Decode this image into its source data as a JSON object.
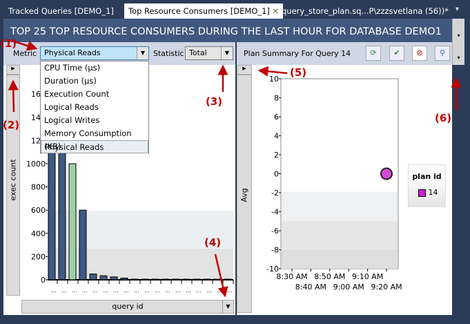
{
  "tabs": [
    {
      "label": "Tracked Queries [DEMO_1]"
    },
    {
      "label": "Top Resource Consumers [DEMO_1]",
      "active": true,
      "close": "✕"
    },
    {
      "label": "query_store_plan.sq...P\\zzzsvetlana (56))*"
    }
  ],
  "header": {
    "title": "TOP 25 TOP RESOURCE CONSUMERS DURING THE LAST HOUR FOR DATABASE DEMO1"
  },
  "toolbar": {
    "metric_label": "Metric",
    "metric_value": "Physical Reads",
    "statistic_label": "Statistic",
    "statistic_value": "Total"
  },
  "metric_options": [
    "CPU Time (µs)",
    "Duration (µs)",
    "Execution Count",
    "Logical Reads",
    "Logical Writes",
    "Memory Consumption (KB)",
    "Physical Reads"
  ],
  "right_toolbar": {
    "title": "Plan Summary For Query 14",
    "icons": [
      "refresh-icon",
      "force-plan-icon",
      "unforce-plan-icon",
      "compare-plans-icon"
    ]
  },
  "annotations": [
    "(1)",
    "(2)",
    "(3)",
    "(4)",
    "(5)",
    "(6)"
  ],
  "colors": {
    "accent": "#41587e",
    "annotation": "#c00000",
    "bar": "#3d5a85",
    "bar_selected": "#9fcfa6",
    "point": "#d84ad8"
  },
  "chart_data": [
    {
      "type": "bar",
      "ylabel": "exec count",
      "xlabel": "query id",
      "ylim": [
        0,
        1700
      ],
      "yticks": [
        "0",
        "200",
        "400",
        "600",
        "800",
        "1000",
        "120",
        "140",
        "160"
      ],
      "values": [
        1250,
        1250,
        1000,
        600,
        50,
        35,
        25,
        15,
        0,
        0,
        0,
        0,
        0,
        0,
        0,
        0,
        0,
        0
      ],
      "selected_index": 2
    },
    {
      "type": "scatter",
      "ylabel": "Avg",
      "ylim": [
        -10,
        10
      ],
      "yticks": [
        "10",
        "8",
        "6",
        "4",
        "2",
        "0",
        "-2",
        "-4",
        "-6",
        "-8",
        "-10"
      ],
      "xticks": [
        "8:30 AM",
        "8:40 AM",
        "8:50 AM",
        "9:00 AM",
        "9:10 AM",
        "9:20 AM"
      ],
      "points": [
        {
          "x": "9:20 AM",
          "y": 0
        }
      ],
      "legend": {
        "title": "plan id",
        "entries": [
          "14"
        ]
      }
    }
  ]
}
